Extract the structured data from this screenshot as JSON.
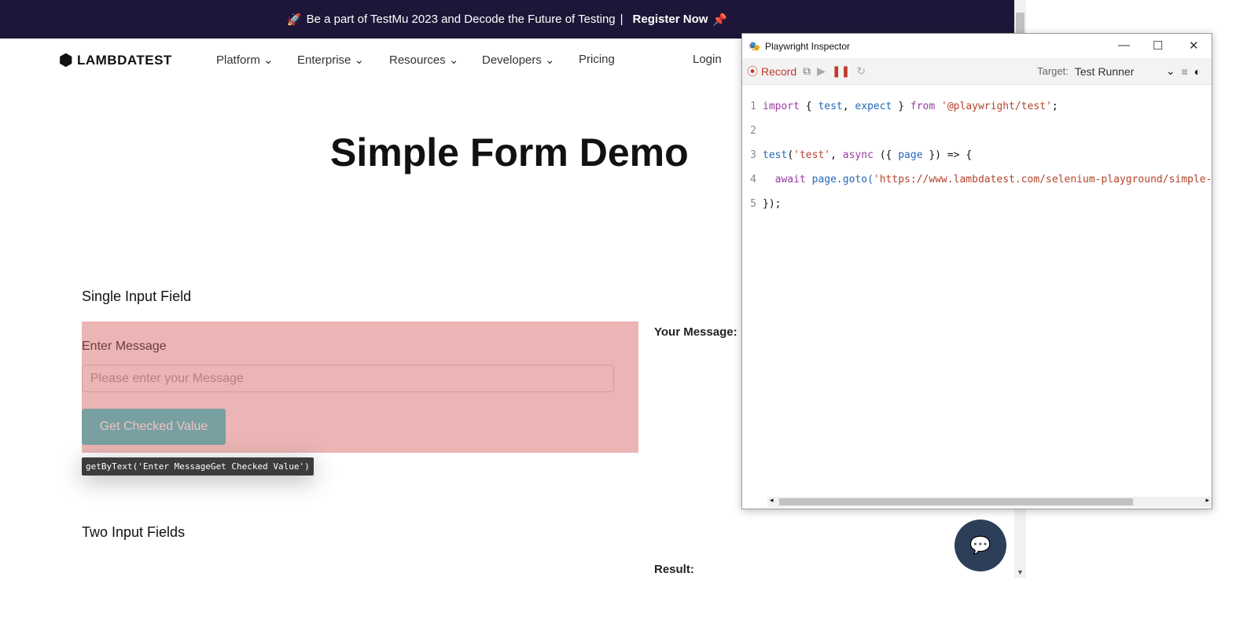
{
  "banner": {
    "text": "Be a part of TestMu 2023 and Decode the Future of Testing",
    "link": "Register Now"
  },
  "nav": {
    "logo": "LAMBDATEST",
    "items": [
      "Platform",
      "Enterprise",
      "Resources",
      "Developers",
      "Pricing"
    ],
    "login": "Login"
  },
  "page": {
    "title": "Simple Form Demo",
    "section1": "Single Input Field",
    "label": "Enter Message",
    "placeholder": "Please enter your Message",
    "button": "Get Checked Value",
    "your_message": "Your Message:",
    "section2": "Two Input Fields",
    "result": "Result:"
  },
  "tooltip": "getByText('Enter MessageGet Checked Value')",
  "inspector": {
    "title": "Playwright Inspector",
    "record": "Record",
    "target_label": "Target:",
    "target_value": "Test Runner",
    "code": {
      "l1": "import",
      "l1b": "{ ",
      "l1c": "test",
      "l1d": ", ",
      "l1e": "expect",
      "l1f": " } ",
      "l1g": "from",
      "l1h": "'@playwright/test'",
      "l1i": ";",
      "l3a": "test",
      "l3b": "(",
      "l3c": "'test'",
      "l3d": ", ",
      "l3e": "async",
      "l3f": " ({ ",
      "l3g": "page",
      "l3h": " }) => {",
      "l4a": "await",
      "l4b": " page.goto(",
      "l4c": "'https://www.lambdatest.com/selenium-playground/simple-form-demo'",
      "l4d": ");",
      "l5": "});"
    }
  },
  "colors": {
    "banner": "#1e1638",
    "highlight": "#ecb5b5",
    "button": "#78a0a0",
    "chat": "#2d3e59",
    "record": "#c0392b"
  }
}
